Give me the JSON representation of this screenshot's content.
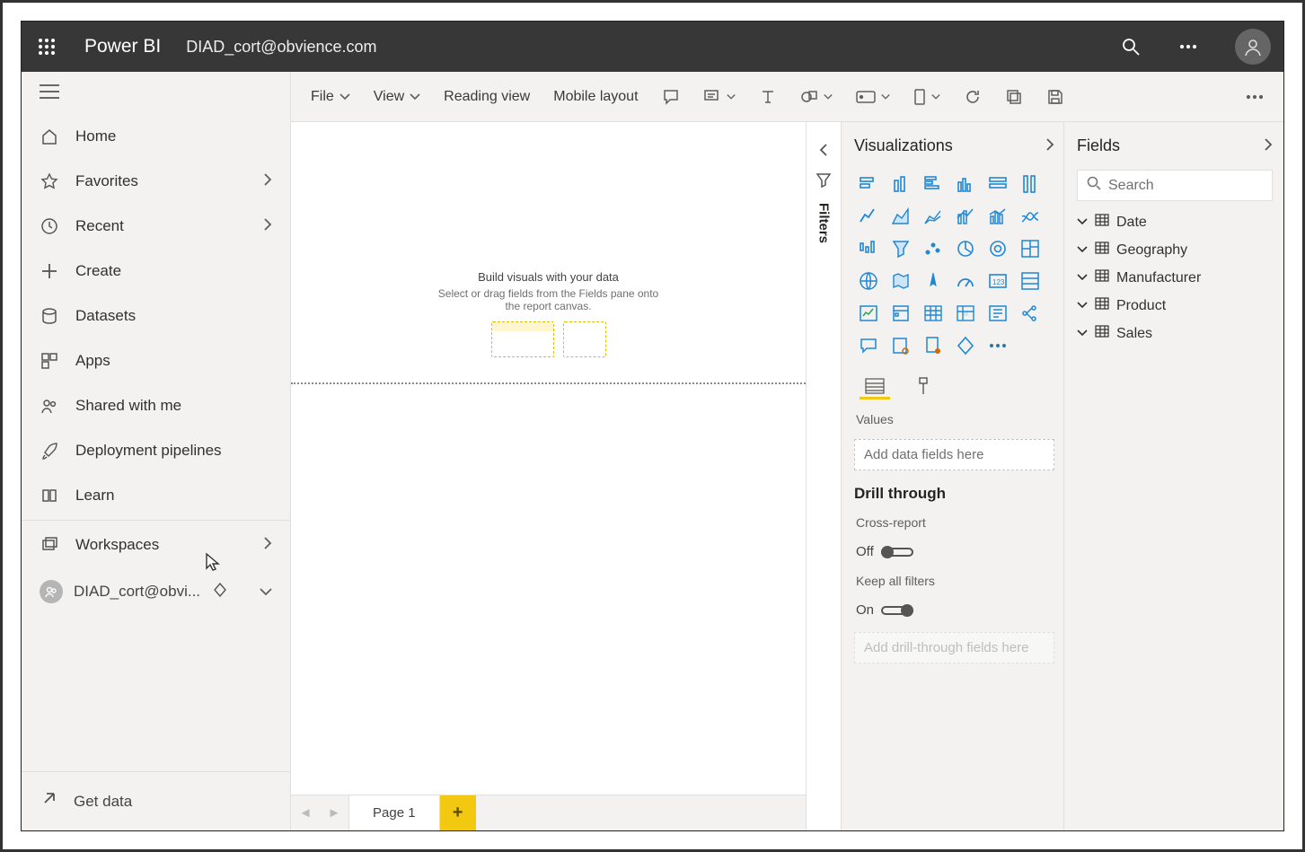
{
  "header": {
    "brand": "Power BI",
    "user_email": "DIAD_cort@obvience.com"
  },
  "nav": {
    "items": [
      {
        "label": "Home",
        "icon": "home-icon"
      },
      {
        "label": "Favorites",
        "icon": "star-icon",
        "chevron": true
      },
      {
        "label": "Recent",
        "icon": "clock-icon",
        "chevron": true
      },
      {
        "label": "Create",
        "icon": "plus-icon"
      },
      {
        "label": "Datasets",
        "icon": "cylinder-icon"
      },
      {
        "label": "Apps",
        "icon": "grid-icon"
      },
      {
        "label": "Shared with me",
        "icon": "people-icon"
      },
      {
        "label": "Deployment pipelines",
        "icon": "rocket-icon"
      },
      {
        "label": "Learn",
        "icon": "book-icon"
      }
    ],
    "workspaces_label": "Workspaces",
    "current_workspace": "DIAD_cort@obvi...",
    "get_data": "Get data"
  },
  "toolbar": {
    "file": "File",
    "view": "View",
    "reading_view": "Reading view",
    "mobile_layout": "Mobile layout"
  },
  "canvas": {
    "placeholder_title": "Build visuals with your data",
    "placeholder_sub": "Select or drag fields from the Fields pane onto the report canvas."
  },
  "pager": {
    "page": "Page 1"
  },
  "filters": {
    "label": "Filters"
  },
  "viz": {
    "title": "Visualizations",
    "values_label": "Values",
    "values_placeholder": "Add data fields here",
    "drill_title": "Drill through",
    "cross_report_label": "Cross-report",
    "cross_report_state": "Off",
    "keep_filters_label": "Keep all filters",
    "keep_filters_state": "On",
    "drill_placeholder": "Add drill-through fields here"
  },
  "fields": {
    "title": "Fields",
    "search_placeholder": "Search",
    "tables": [
      "Date",
      "Geography",
      "Manufacturer",
      "Product",
      "Sales"
    ]
  }
}
